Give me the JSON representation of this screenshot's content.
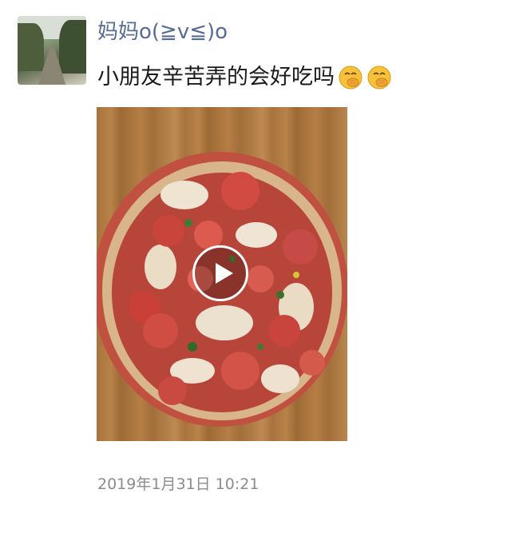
{
  "post": {
    "author_name": "妈妈o(≧v≦)o",
    "text": "小朋友辛苦弄的会好吃吗",
    "emojis": [
      "smirk-hand-over-mouth-icon",
      "smirk-hand-over-mouth-icon"
    ],
    "media_type": "video",
    "timestamp": "2019年1月31日 10:21"
  }
}
